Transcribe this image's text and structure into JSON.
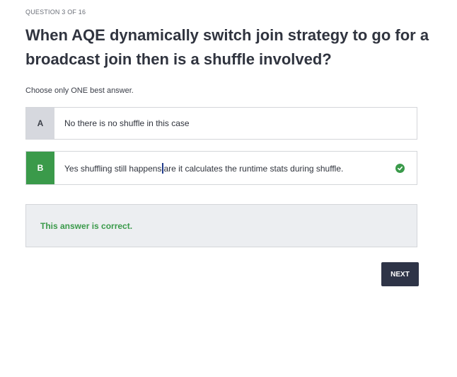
{
  "quiz": {
    "counter": "QUESTION 3 OF 16",
    "question": "When AQE dynamically switch join strategy to go for a broadcast join then is a shuffle involved?",
    "instruction": "Choose only ONE best answer.",
    "options": [
      {
        "letter": "A",
        "text": "No there is no shuffle in this case",
        "state": "unselected"
      },
      {
        "letter": "B",
        "text_before_caret": "Yes shuffling still happens",
        "text_after_caret": "are it calculates the runtime stats during shuffle.",
        "state": "correct",
        "status_icon": "check-circle-icon"
      }
    ],
    "feedback": "This answer is correct.",
    "next_label": "NEXT"
  },
  "colors": {
    "correct_green": "#3a9a4a",
    "neutral_letter_bg": "#d6d8de",
    "feedback_bg": "#eceef1",
    "button_bg": "#2e3447"
  }
}
